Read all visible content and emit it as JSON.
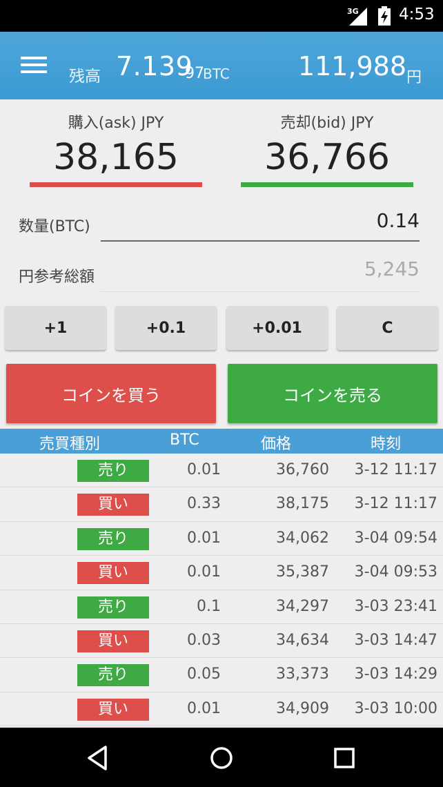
{
  "status": {
    "network": "3G",
    "time": "4:53"
  },
  "header": {
    "balance_label": "残高",
    "btc_main": "7.139",
    "btc_small": "97",
    "btc_unit": "BTC",
    "jpy_value": "111,988",
    "jpy_unit": "円"
  },
  "prices": {
    "ask_label": "購入(ask) JPY",
    "ask_value": "38,165",
    "bid_label": "売却(bid) JPY",
    "bid_value": "36,766"
  },
  "form": {
    "qty_label": "数量(BTC)",
    "qty_value": "0.14",
    "ref_label": "円参考総額",
    "ref_value": "5,245"
  },
  "increments": [
    "+1",
    "+0.1",
    "+0.01",
    "C"
  ],
  "actions": {
    "buy": "コインを買う",
    "sell": "コインを売る"
  },
  "table": {
    "headers": {
      "type": "売買種別",
      "btc": "BTC",
      "price": "価格",
      "time": "時刻"
    },
    "rows": [
      {
        "side": "sell",
        "label": "売り",
        "btc": "0.01",
        "price": "36,760",
        "time": "3-12 11:17"
      },
      {
        "side": "buy",
        "label": "買い",
        "btc": "0.33",
        "price": "38,175",
        "time": "3-12 11:17"
      },
      {
        "side": "sell",
        "label": "売り",
        "btc": "0.01",
        "price": "34,062",
        "time": "3-04 09:54"
      },
      {
        "side": "buy",
        "label": "買い",
        "btc": "0.01",
        "price": "35,387",
        "time": "3-04 09:53"
      },
      {
        "side": "sell",
        "label": "売り",
        "btc": "0.1",
        "price": "34,297",
        "time": "3-03 23:41"
      },
      {
        "side": "buy",
        "label": "買い",
        "btc": "0.03",
        "price": "34,634",
        "time": "3-03 14:47"
      },
      {
        "side": "sell",
        "label": "売り",
        "btc": "0.05",
        "price": "33,373",
        "time": "3-03 14:29"
      },
      {
        "side": "buy",
        "label": "買い",
        "btc": "0.01",
        "price": "34,909",
        "time": "3-03 10:00"
      }
    ]
  },
  "colors": {
    "buy": "#de4e4a",
    "sell": "#3daa44",
    "primary": "#4b9fd7"
  },
  "icons": {
    "menu": "menu-icon",
    "back": "back-icon",
    "home": "home-icon",
    "recents": "recents-icon"
  }
}
